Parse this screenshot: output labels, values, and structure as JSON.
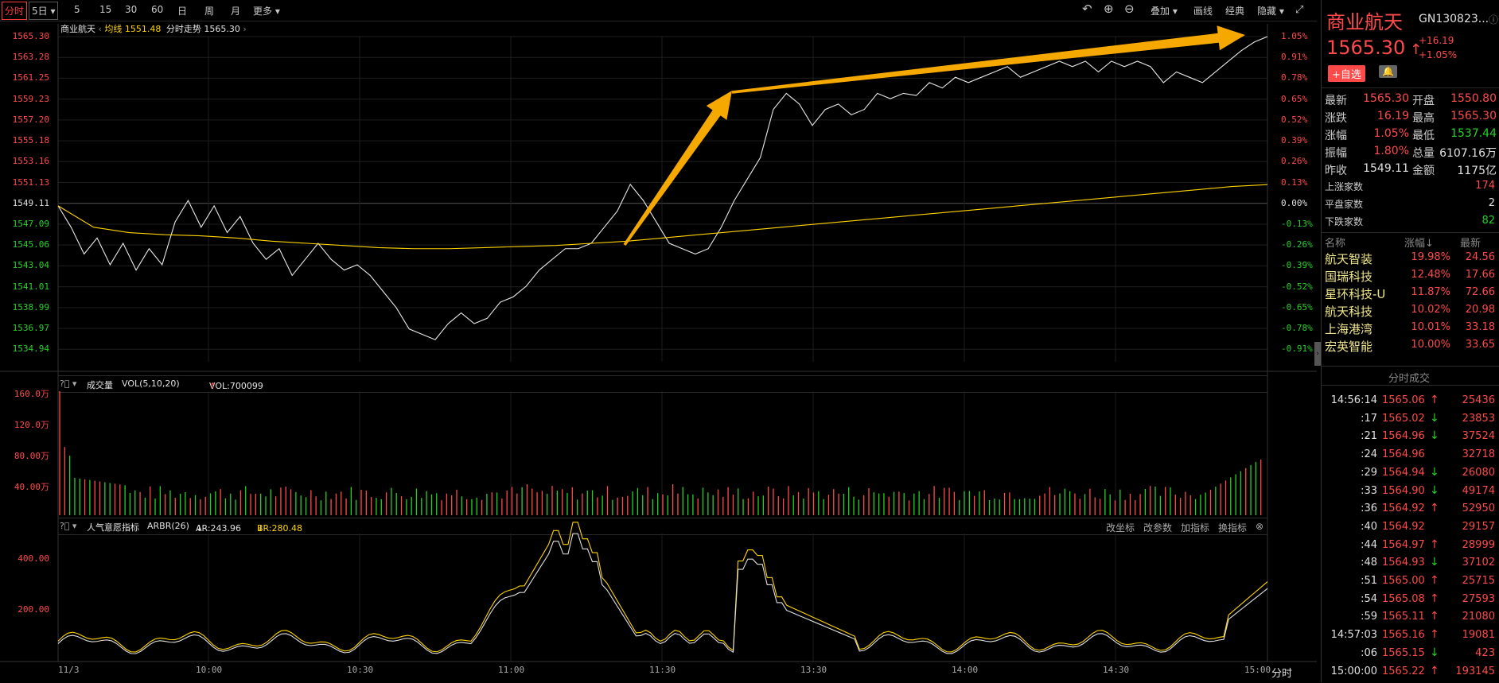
{
  "toolbar": {
    "periods": [
      "分时",
      "5日",
      "5",
      "15",
      "30",
      "60",
      "日",
      "周",
      "月",
      "更多"
    ],
    "right": [
      "叠加",
      "画线",
      "经典",
      "隐藏"
    ]
  },
  "price_header": {
    "name": "商业航天",
    "ma_label": "均线",
    "ma_value": "1551.48",
    "trend_label": "分时走势",
    "trend_value": "1565.30"
  },
  "price_axis_left": [
    "1565.30",
    "1563.28",
    "1561.25",
    "1559.23",
    "1557.20",
    "1555.18",
    "1553.16",
    "1551.13",
    "1549.11",
    "1547.09",
    "1545.06",
    "1543.04",
    "1541.01",
    "1538.99",
    "1536.97",
    "1534.94"
  ],
  "price_axis_right": [
    "1.05%",
    "0.91%",
    "0.78%",
    "0.65%",
    "0.52%",
    "0.39%",
    "0.26%",
    "0.13%",
    "0.00%",
    "-0.13%",
    "-0.26%",
    "-0.39%",
    "-0.52%",
    "-0.65%",
    "-0.78%",
    "-0.91%"
  ],
  "volume_header": {
    "title": "成交量",
    "params": "VOL(5,10,20)",
    "vol_label": "VOL:700099"
  },
  "volume_axis": [
    "160.0万",
    "120.0万",
    "80.00万",
    "40.00万"
  ],
  "arbr_header": {
    "title": "人气意愿指标",
    "params": "ARBR(26)",
    "ar": "AR:243.96",
    "br": "BR:280.48"
  },
  "arbr_buttons": [
    "改坐标",
    "改参数",
    "加指标",
    "换指标"
  ],
  "arbr_axis": [
    "400.00",
    "200.00"
  ],
  "time_axis": [
    "11/3",
    "10:00",
    "10:30",
    "11:00",
    "11:30",
    "13:30",
    "14:00",
    "14:30",
    "15:00",
    "分时"
  ],
  "colors": {
    "up": "#ff4a4a",
    "down": "#26d126",
    "avg": "#ffd400",
    "arrow": "#f5a800"
  },
  "chart_data": {
    "type": "line",
    "title": "商业航天",
    "series": [
      {
        "name": "分时走势",
        "values": [
          1549.5,
          1547.5,
          1545.0,
          1546.5,
          1544.0,
          1546.0,
          1543.5,
          1545.5,
          1544.0,
          1548.0,
          1550.0,
          1547.5,
          1549.5,
          1547.0,
          1548.5,
          1546.0,
          1544.5,
          1545.5,
          1543.0,
          1544.5,
          1546.0,
          1544.5,
          1543.5,
          1544.0,
          1543.0,
          1541.5,
          1540.0,
          1538.0,
          1537.5,
          1537.0,
          1538.5,
          1539.5,
          1538.5,
          1539.0,
          1540.5,
          1541.0,
          1542.0,
          1543.5,
          1544.5,
          1545.5,
          1545.5,
          1546.0,
          1547.5,
          1549.0,
          1551.5,
          1550.0,
          1548.0,
          1546.0,
          1545.5,
          1545.0,
          1545.5,
          1547.5,
          1550.0,
          1552.0,
          1554.0,
          1558.5,
          1560.0,
          1559.0,
          1557.0,
          1558.5,
          1559.0,
          1558.0,
          1558.5,
          1560.0,
          1559.5,
          1560.0,
          1559.8,
          1561.0,
          1560.5,
          1561.5,
          1561.0,
          1561.5,
          1562.0,
          1562.5,
          1561.5,
          1562.0,
          1562.5,
          1563.0,
          1562.5,
          1563.0,
          1562.0,
          1563.0,
          1562.5,
          1563.0,
          1562.5,
          1561.0,
          1562.0,
          1561.5,
          1561.0,
          1562.0,
          1563.0,
          1564.0,
          1564.8,
          1565.3
        ]
      },
      {
        "name": "均线",
        "values": [
          1549.5,
          1547.5,
          1547.0,
          1546.8,
          1546.7,
          1546.5,
          1546.2,
          1546.0,
          1545.8,
          1545.6,
          1545.5,
          1545.5,
          1545.6,
          1545.7,
          1545.8,
          1546.0,
          1546.2,
          1546.5,
          1546.8,
          1547.1,
          1547.4,
          1547.7,
          1548.0,
          1548.3,
          1548.6,
          1548.9,
          1549.2,
          1549.5,
          1549.8,
          1550.1,
          1550.4,
          1550.7,
          1551.0,
          1551.3,
          1551.48
        ]
      }
    ],
    "ylim": [
      1534.94,
      1565.3
    ],
    "volume": {
      "max": 1600000,
      "ylim": [
        0,
        1600000
      ]
    },
    "arbr": {
      "ylim": [
        0,
        500
      ],
      "ar_last": 243.96,
      "br_last": 280.48
    }
  },
  "quote": {
    "name": "商业航天",
    "code": "GN130823...",
    "price": "1565.30",
    "change": "+16.19",
    "change_pct": "+1.05%",
    "add_watch": "+自选",
    "stats": [
      {
        "l1": "最新",
        "v1": "1565.30",
        "c1": "red",
        "l2": "开盘",
        "v2": "1550.80",
        "c2": "red"
      },
      {
        "l1": "涨跌",
        "v1": "16.19",
        "c1": "red",
        "l2": "最高",
        "v2": "1565.30",
        "c2": "red"
      },
      {
        "l1": "涨幅",
        "v1": "1.05%",
        "c1": "red",
        "l2": "最低",
        "v2": "1537.44",
        "c2": "grn"
      },
      {
        "l1": "振幅",
        "v1": "1.80%",
        "c1": "red",
        "l2": "总量",
        "v2": "6107.16万",
        "c2": "wht"
      },
      {
        "l1": "昨收",
        "v1": "1549.11",
        "c1": "wht",
        "l2": "金额",
        "v2": "1175亿",
        "c2": "wht"
      }
    ],
    "counts": [
      {
        "label": "上涨家数",
        "value": "174",
        "color": "red"
      },
      {
        "label": "平盘家数",
        "value": "2",
        "color": "wht"
      },
      {
        "label": "下跌家数",
        "value": "82",
        "color": "grn"
      }
    ]
  },
  "constituents": {
    "headers": [
      "名称",
      "涨幅",
      "最新"
    ],
    "rows": [
      {
        "name": "航天智装",
        "pct": "19.98%",
        "price": "24.56"
      },
      {
        "name": "国瑞科技",
        "pct": "12.48%",
        "price": "17.66"
      },
      {
        "name": "星环科技-U",
        "pct": "11.87%",
        "price": "72.66"
      },
      {
        "name": "航天科技",
        "pct": "10.02%",
        "price": "20.98"
      },
      {
        "name": "上海港湾",
        "pct": "10.01%",
        "price": "33.18"
      },
      {
        "name": "宏英智能",
        "pct": "10.00%",
        "price": "33.65"
      }
    ]
  },
  "ticks": {
    "title": "分时成交",
    "rows": [
      {
        "t": "14:56:14",
        "p": "1565.06",
        "d": "up",
        "v": "25436"
      },
      {
        "t": ":17",
        "p": "1565.02",
        "d": "down",
        "v": "23853"
      },
      {
        "t": ":21",
        "p": "1564.96",
        "d": "down",
        "v": "37524"
      },
      {
        "t": ":24",
        "p": "1564.96",
        "d": "",
        "v": "32718"
      },
      {
        "t": ":29",
        "p": "1564.94",
        "d": "down",
        "v": "26080"
      },
      {
        "t": ":33",
        "p": "1564.90",
        "d": "down",
        "v": "49174"
      },
      {
        "t": ":36",
        "p": "1564.92",
        "d": "up",
        "v": "52950"
      },
      {
        "t": ":40",
        "p": "1564.92",
        "d": "",
        "v": "29157"
      },
      {
        "t": ":44",
        "p": "1564.97",
        "d": "up",
        "v": "28999"
      },
      {
        "t": ":48",
        "p": "1564.93",
        "d": "down",
        "v": "37102"
      },
      {
        "t": ":51",
        "p": "1565.00",
        "d": "up",
        "v": "25715"
      },
      {
        "t": ":54",
        "p": "1565.08",
        "d": "up",
        "v": "27593"
      },
      {
        "t": ":59",
        "p": "1565.11",
        "d": "up",
        "v": "21080"
      },
      {
        "t": "14:57:03",
        "p": "1565.16",
        "d": "up",
        "v": "19081"
      },
      {
        "t": ":06",
        "p": "1565.15",
        "d": "down",
        "v": "423"
      },
      {
        "t": "15:00:00",
        "p": "1565.22",
        "d": "up",
        "v": "193145"
      }
    ]
  }
}
